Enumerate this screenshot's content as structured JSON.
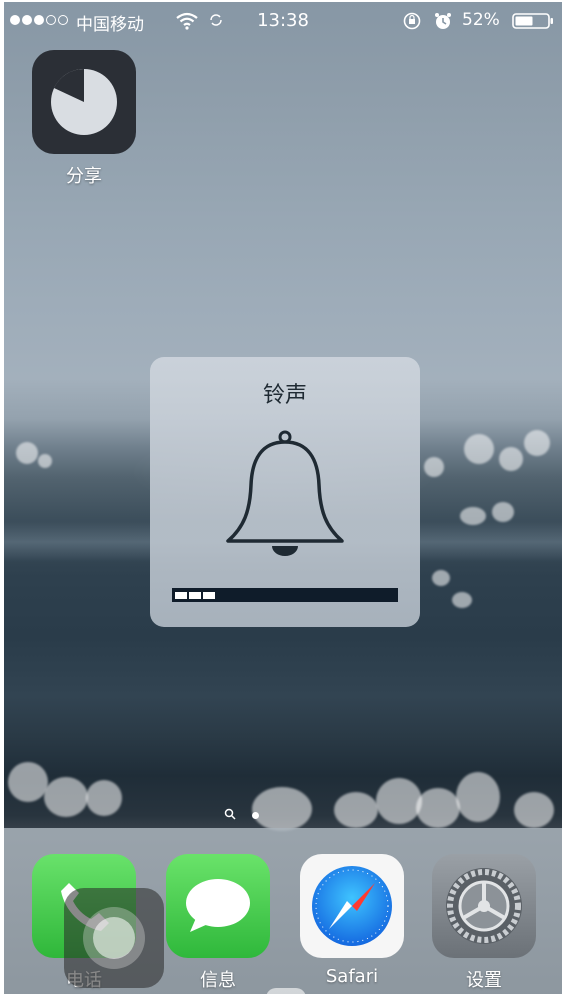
{
  "status_bar": {
    "carrier": "中国移动",
    "time": "13:38",
    "battery": "52%",
    "signal_bars_filled": 3,
    "signal_bars_total": 5
  },
  "home": {
    "apps": [
      {
        "label": "分享",
        "icon": "pie-chart-icon"
      }
    ]
  },
  "volume_hud": {
    "title": "铃声",
    "icon": "bell-icon",
    "level_fraction": 0.19
  },
  "dock": {
    "apps": [
      {
        "label": "电话",
        "icon": "phone-icon",
        "color": "#4cd964"
      },
      {
        "label": "信息",
        "icon": "message-bubble-icon",
        "color": "#4cd964"
      },
      {
        "label": "Safari",
        "icon": "compass-icon",
        "color": "#1e8ef0"
      },
      {
        "label": "设置",
        "icon": "gear-icon",
        "color": "#8e8e93"
      }
    ]
  }
}
